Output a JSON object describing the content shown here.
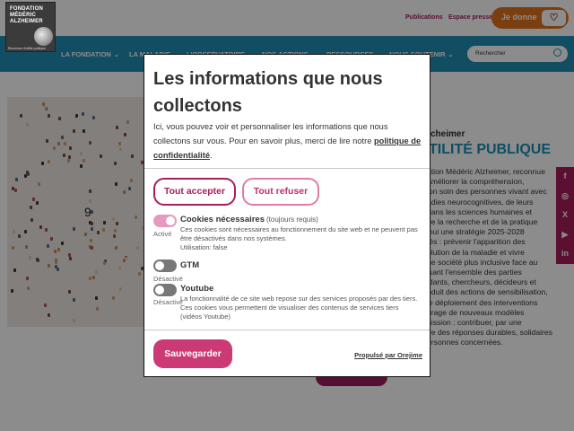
{
  "site": {
    "logo_line1": "FONDATION",
    "logo_line2": "MÉDÉRIC",
    "logo_line3": "ALZHEIMER",
    "logo_tagline": "Reconnue d'utilité publique",
    "links": [
      "Publications",
      "Espace presse"
    ],
    "donate_label": "Je donne",
    "nav": [
      {
        "label": "LA FONDATION"
      },
      {
        "label": "LA MALADIE"
      },
      {
        "label": "L'OBSERVATOIRE"
      },
      {
        "label": "NOS ACTIONS"
      },
      {
        "label": "RESSOURCES"
      },
      {
        "label": "NOUS SOUTENIR"
      }
    ],
    "search_placeholder": "Rechercher",
    "hero_image_number": "9",
    "hero_eyebrow": "cheimer",
    "hero_heading": "TILITÉ PUBLIQUE",
    "hero_text": [
      "ation Médéric Alzheimer, reconnue",
      "améliorer la compréhension,",
      "ion soin des personnes vivant avec",
      "adies neurocognitives, de leurs",
      "dans les sciences humaines et",
      "de la recherche et de la pratique",
      "'hui une stratégie 2025-2028",
      "tés : prévenir l'apparition des",
      "olution de la maladie et vivre",
      "ne société plus inclusive face au",
      "isant l'ensemble des parties",
      "idants, chercheurs, décideurs et",
      "nduit des actions de sensibilisation,",
      "le déploiement des interventions",
      "urage de nouveaux modèles",
      "nission : contribuer, par une",
      "ire des réponses durables, solidaires",
      "ersonnes concernées."
    ],
    "social_icons": [
      "facebook-icon",
      "instagram-icon",
      "x-icon",
      "youtube-icon",
      "linkedin-icon"
    ],
    "social_glyphs": [
      "f",
      "◎",
      "X",
      "▶",
      "in"
    ]
  },
  "consent": {
    "title": "Les informations que nous collectons",
    "description_prefix": "Ici, vous pouvez voir et personnaliser les informations que nous collectons sur vous.  Pour en savoir plus, merci de lire notre ",
    "policy_link": "politique de confidentialité",
    "description_suffix": ".",
    "accept_label": "Tout accepter",
    "refuse_label": "Tout refuser",
    "services": [
      {
        "title": "Cookies nécessaires",
        "required_note": "(toujours requis)",
        "status": "Activé",
        "enabled": true,
        "description": "Ces cookies sont nécessaires au fonctionnement du site web et ne peuvent pas être désactivés dans nos systèmes.",
        "purpose": "Utilisation: false"
      },
      {
        "title": "GTM",
        "status": "Désactivé",
        "enabled": false
      },
      {
        "title": "Youtube",
        "status": "Désactivé",
        "enabled": false,
        "description": "La fonctionnalité de ce site web repose sur des services proposés par des tiers. Ces cookies vous permettent de visualiser des contenus de services tiers (vidéos Youtube)"
      }
    ],
    "save_label": "Sauvegarder",
    "powered_by": "Propulsé par Orejime"
  },
  "colors": {
    "primary": "#a81e5a",
    "nav_blue": "#1f8fb4",
    "donate_orange": "#e0711d"
  }
}
